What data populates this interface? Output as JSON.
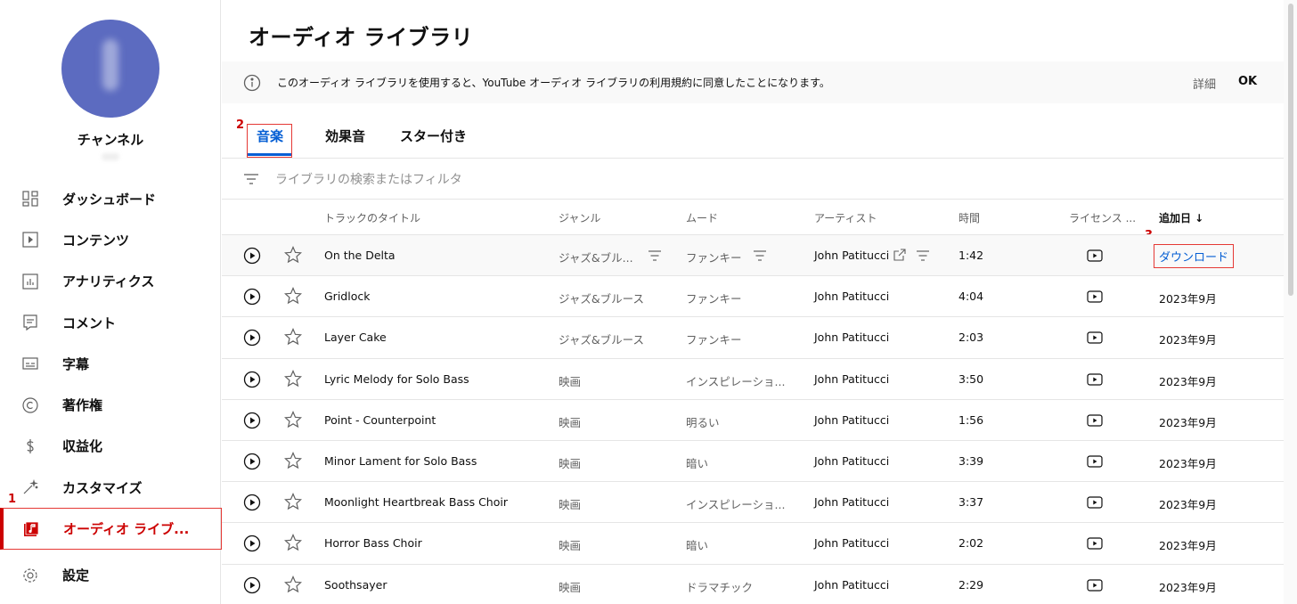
{
  "sidebar": {
    "channel_name": "チャンネル",
    "items": [
      {
        "label": "ダッシュボード",
        "icon": "dashboard-icon"
      },
      {
        "label": "コンテンツ",
        "icon": "content-icon"
      },
      {
        "label": "アナリティクス",
        "icon": "analytics-icon"
      },
      {
        "label": "コメント",
        "icon": "comments-icon"
      },
      {
        "label": "字幕",
        "icon": "subtitles-icon"
      },
      {
        "label": "著作権",
        "icon": "copyright-icon"
      },
      {
        "label": "収益化",
        "icon": "monetization-icon"
      },
      {
        "label": "カスタマイズ",
        "icon": "customize-icon"
      },
      {
        "label": "オーディオ ライブ...",
        "icon": "audio-library-icon",
        "active": true
      },
      {
        "label": "設定",
        "icon": "settings-icon"
      }
    ]
  },
  "markers": {
    "m1": "1",
    "m2": "2",
    "m3": "3"
  },
  "page": {
    "title": "オーディオ ライブラリ"
  },
  "notice": {
    "text": "このオーディオ ライブラリを使用すると、YouTube オーディオ ライブラリの利用規約に同意したことになります。",
    "details": "詳細",
    "ok": "OK"
  },
  "tabs": [
    {
      "label": "音楽",
      "active": true
    },
    {
      "label": "効果音"
    },
    {
      "label": "スター付き"
    }
  ],
  "search": {
    "placeholder": "ライブラリの検索またはフィルタ"
  },
  "table": {
    "headers": {
      "title": "トラックのタイトル",
      "genre": "ジャンル",
      "mood": "ムード",
      "artist": "アーティスト",
      "duration": "時間",
      "license": "ライセンス ...",
      "added": "追加日 ↓"
    },
    "rows": [
      {
        "title": "On the Delta",
        "genre": "ジャズ&ブル...",
        "mood": "ファンキー",
        "artist": "John Patitucci",
        "duration": "1:42",
        "added": "ダウンロード"
      },
      {
        "title": "Gridlock",
        "genre": "ジャズ&ブルース",
        "mood": "ファンキー",
        "artist": "John Patitucci",
        "duration": "4:04",
        "added": "2023年9月"
      },
      {
        "title": "Layer Cake",
        "genre": "ジャズ&ブルース",
        "mood": "ファンキー",
        "artist": "John Patitucci",
        "duration": "2:03",
        "added": "2023年9月"
      },
      {
        "title": "Lyric Melody for Solo Bass",
        "genre": "映画",
        "mood": "インスピレーショ...",
        "artist": "John Patitucci",
        "duration": "3:50",
        "added": "2023年9月"
      },
      {
        "title": "Point - Counterpoint",
        "genre": "映画",
        "mood": "明るい",
        "artist": "John Patitucci",
        "duration": "1:56",
        "added": "2023年9月"
      },
      {
        "title": "Minor Lament for Solo Bass",
        "genre": "映画",
        "mood": "暗い",
        "artist": "John Patitucci",
        "duration": "3:39",
        "added": "2023年9月"
      },
      {
        "title": "Moonlight Heartbreak Bass Choir",
        "genre": "映画",
        "mood": "インスピレーショ...",
        "artist": "John Patitucci",
        "duration": "3:37",
        "added": "2023年9月"
      },
      {
        "title": "Horror Bass Choir",
        "genre": "映画",
        "mood": "暗い",
        "artist": "John Patitucci",
        "duration": "2:02",
        "added": "2023年9月"
      },
      {
        "title": "Soothsayer",
        "genre": "映画",
        "mood": "ドラマチック",
        "artist": "John Patitucci",
        "duration": "2:29",
        "added": "2023年9月"
      }
    ]
  },
  "colors": {
    "accent": "#065fd4",
    "brand_red": "#cc0000",
    "highlight_border": "#e53935"
  }
}
